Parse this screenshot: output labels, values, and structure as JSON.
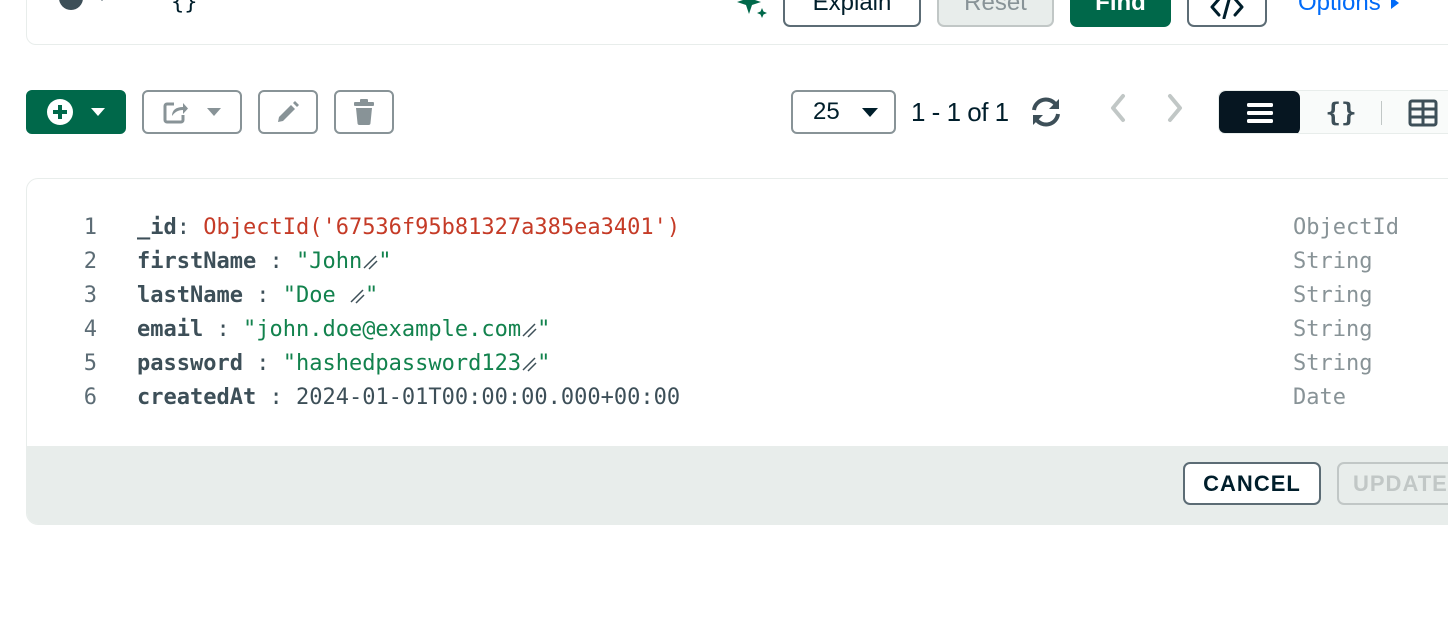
{
  "query_bar": {
    "filter_value": "{}",
    "explain_label": "Explain",
    "reset_label": "Reset",
    "find_label": "Find",
    "options_label": "Options"
  },
  "toolbar": {
    "page_size": "25",
    "range": "1 - 1 of 1"
  },
  "document": {
    "lines": [
      {
        "n": "1",
        "key": "_id",
        "sep": ": ",
        "value": "ObjectId('67536f95b81327a385ea3401')",
        "value_kind": "objectid",
        "type": "ObjectId"
      },
      {
        "n": "2",
        "key": "firstName",
        "sep": " : ",
        "value": "\"John\"",
        "value_kind": "string",
        "type": "String"
      },
      {
        "n": "3",
        "key": "lastName",
        "sep": " : ",
        "value": "\"Doe \"",
        "value_kind": "string",
        "type": "String"
      },
      {
        "n": "4",
        "key": "email",
        "sep": " : ",
        "value": "\"john.doe@example.com\"",
        "value_kind": "string",
        "type": "String"
      },
      {
        "n": "5",
        "key": "password",
        "sep": " : ",
        "value": "\"hashedpassword123\"",
        "value_kind": "string",
        "type": "String"
      },
      {
        "n": "6",
        "key": "createdAt",
        "sep": " : ",
        "value": "2024-01-01T00:00:00.000+00:00",
        "value_kind": "date",
        "type": "Date"
      }
    ],
    "cancel_label": "CANCEL",
    "update_label": "UPDATE"
  },
  "colors": {
    "primary_green": "#00684a",
    "objectid_red": "#c53b27",
    "string_green": "#12824d",
    "link_blue": "#016bf8",
    "dark_navy": "#061621"
  },
  "icons": [
    "history-icon",
    "sparkle-icon",
    "code-icon",
    "add-icon",
    "export-icon",
    "pencil-icon",
    "trash-icon",
    "refresh-icon",
    "chevron-left-icon",
    "chevron-right-icon",
    "list-view-icon",
    "json-view-icon",
    "table-view-icon"
  ]
}
